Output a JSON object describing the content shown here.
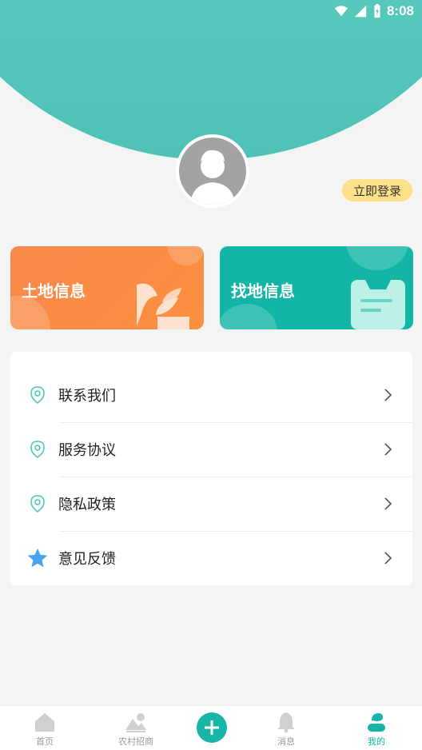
{
  "status_bar": {
    "time": "8:08",
    "icons": [
      "wifi-icon",
      "signal-icon",
      "battery-icon"
    ]
  },
  "profile": {
    "avatar_icon": "user-avatar-icon",
    "login_label": "立即登录"
  },
  "cards": [
    {
      "title": "土地信息",
      "icon": "plant-leaf-icon",
      "color": "#fb8a44"
    },
    {
      "title": "找地信息",
      "icon": "clipboard-icon",
      "color": "#13b5a6"
    }
  ],
  "menu": [
    {
      "label": "联系我们",
      "icon": "location-pin-icon"
    },
    {
      "label": "服务协议",
      "icon": "location-pin-icon"
    },
    {
      "label": "隐私政策",
      "icon": "location-pin-icon"
    },
    {
      "label": "意见反馈",
      "icon": "star-icon"
    }
  ],
  "bottom_nav": [
    {
      "label": "首页",
      "icon": "home-icon",
      "active": false
    },
    {
      "label": "农村招商",
      "icon": "landscape-icon",
      "active": false
    },
    {
      "label": "",
      "icon": "plus-icon",
      "active": false
    },
    {
      "label": "消息",
      "icon": "bell-icon",
      "active": false
    },
    {
      "label": "我的",
      "icon": "profile-icon",
      "active": true
    }
  ],
  "colors": {
    "accent": "#13b5a6",
    "header": "#5fd2c6",
    "orange": "#fb8a44",
    "login_bg": "#fde08a"
  }
}
